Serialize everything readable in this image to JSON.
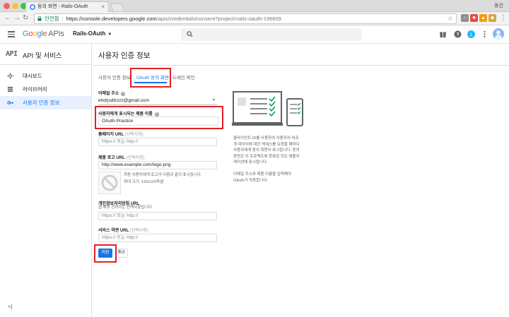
{
  "browser": {
    "tab_title": "동의 화면 - Rails-OAuth",
    "profile_name": "동건",
    "secure_label": "안전함",
    "url_host": "https://console.developers.google.com",
    "url_path": "/apis/credentials/consent?project=rails-oauth-196609"
  },
  "header": {
    "logo_google": "Google",
    "logo_apis": "APIs",
    "project_name": "Rails-OAuth"
  },
  "sidebar": {
    "title": "API 및 서비스",
    "api_glyph": "API",
    "items": [
      {
        "label": "대시보드"
      },
      {
        "label": "라이브러리"
      },
      {
        "label": "사용자 인증 정보"
      }
    ],
    "collapse": "<|"
  },
  "main": {
    "page_title": "사용자 인증 정보",
    "tabs": [
      {
        "label": "사용자 인증 정보"
      },
      {
        "label": "OAuth 동의 화면"
      },
      {
        "label": "도메인 확인"
      }
    ],
    "email": {
      "label": "이메일 주소",
      "value": "ehdrjsdlzzzz@gmail.com"
    },
    "product_name": {
      "label": "사용자에게 표시되는 제품 이름",
      "value": "OAuth-Practice"
    },
    "homepage": {
      "label": "홈페이지 URL",
      "optional": "(선택사항)",
      "placeholder": "https:// 또는 http://"
    },
    "product_logo": {
      "label": "제품 로고 URL",
      "optional": "(선택사항)",
      "placeholder": "http://www.example.com/logo.png",
      "note1": "최종 사용자에게 로고가 다음과 같이 표시됩니다.",
      "note2": "최대 크기: 120x120픽셀"
    },
    "privacy": {
      "label": "개인정보처리방침 URL",
      "note": "앱 배포 전까지는 선택사항입니다.",
      "placeholder": "https:// 또는 http://"
    },
    "tos": {
      "label": "서비스 약관 URL",
      "optional": "(선택사항)",
      "placeholder": "https:// 또는 http://"
    },
    "buttons": {
      "save": "저장",
      "cancel": "취소"
    },
    "info": {
      "p1": [
        "클라이언트 ID를 사용하여 사용자의 비공",
        "개 데이터에 대한 액세스를 요청할 때마다",
        "사용자에게 동의 화면이 표시됩니다. 동의",
        "화면은 이 프로젝트에 등록된 모든 애플리",
        "케이션에 표시됩니다."
      ],
      "p2": [
        "이메일 주소와 제품 이름을 입력해야",
        "OAuth가 작동합니다."
      ]
    }
  },
  "colors": {
    "accent": "#1a73e8",
    "annotation_red": "#e21f26",
    "check_green": "#0f9d58"
  }
}
